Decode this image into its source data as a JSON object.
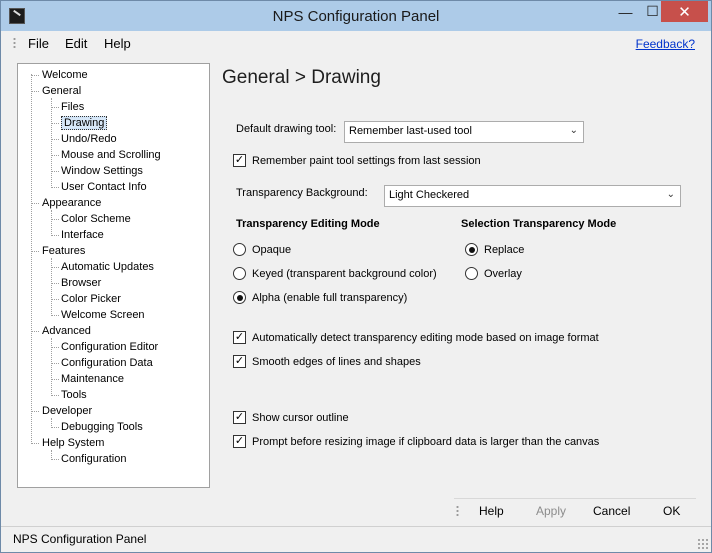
{
  "window": {
    "title": "NPS Configuration Panel",
    "minimize_glyph": "—",
    "maximize_glyph": "☐",
    "close_glyph": "✕"
  },
  "menu": {
    "items": [
      "File",
      "Edit",
      "Help"
    ],
    "feedback_link": "Feedback?"
  },
  "tree": {
    "items": [
      {
        "label": "Welcome"
      },
      {
        "label": "General"
      },
      {
        "label": "Files"
      },
      {
        "label": "Drawing",
        "selected": true
      },
      {
        "label": "Undo/Redo"
      },
      {
        "label": "Mouse and Scrolling"
      },
      {
        "label": "Window Settings"
      },
      {
        "label": "User Contact Info"
      },
      {
        "label": "Appearance"
      },
      {
        "label": "Color Scheme"
      },
      {
        "label": "Interface"
      },
      {
        "label": "Features"
      },
      {
        "label": "Automatic Updates"
      },
      {
        "label": "Browser"
      },
      {
        "label": "Color Picker"
      },
      {
        "label": "Welcome Screen"
      },
      {
        "label": "Advanced"
      },
      {
        "label": "Configuration Editor"
      },
      {
        "label": "Configuration Data"
      },
      {
        "label": "Maintenance"
      },
      {
        "label": "Tools"
      },
      {
        "label": "Developer"
      },
      {
        "label": "Debugging Tools"
      },
      {
        "label": "Help System"
      },
      {
        "label": "Configuration"
      }
    ]
  },
  "page": {
    "title": "General > Drawing",
    "default_tool_label": "Default drawing tool:",
    "default_tool_value": "Remember last-used tool",
    "remember_settings_label": "Remember paint tool settings from last session",
    "remember_settings_checked": true,
    "transparency_bg_label": "Transparency Background:",
    "transparency_bg_value": "Light Checkered",
    "editing_mode_heading": "Transparency Editing Mode",
    "editing_modes": [
      {
        "label": "Opaque",
        "selected": false
      },
      {
        "label": "Keyed (transparent background color)",
        "selected": false
      },
      {
        "label": "Alpha (enable full transparency)",
        "selected": true
      }
    ],
    "selection_mode_heading": "Selection Transparency Mode",
    "selection_modes": [
      {
        "label": "Replace",
        "selected": true
      },
      {
        "label": "Overlay",
        "selected": false
      }
    ],
    "auto_detect_label": "Automatically detect transparency editing mode based on image format",
    "auto_detect_checked": true,
    "smooth_edges_label": "Smooth edges of lines and shapes",
    "smooth_edges_checked": true,
    "cursor_outline_label": "Show cursor outline",
    "cursor_outline_checked": true,
    "prompt_resize_label": "Prompt before resizing image if clipboard data is larger than the canvas",
    "prompt_resize_checked": true,
    "check_glyph": "✓",
    "dropdown_glyph": "⌄"
  },
  "buttons": {
    "help": "Help",
    "apply": "Apply",
    "cancel": "Cancel",
    "ok": "OK"
  },
  "status": {
    "text": "NPS Configuration Panel"
  }
}
